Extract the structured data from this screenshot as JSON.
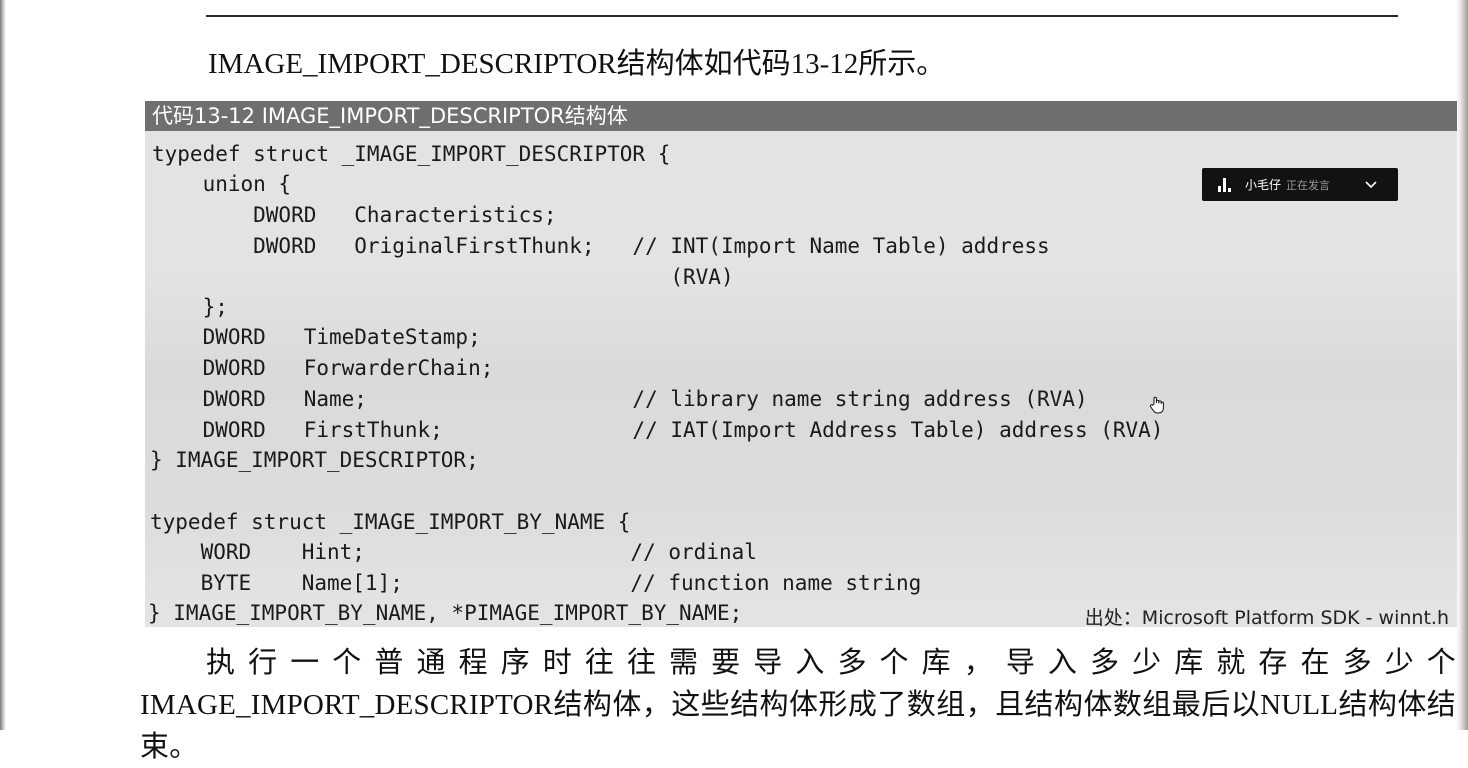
{
  "intro_text": "IMAGE_IMPORT_DESCRIPTOR结构体如代码13-12所示。",
  "code_block": {
    "header": "代码13-12   IMAGE_IMPORT_DESCRIPTOR结构体",
    "lines": [
      "typedef struct _IMAGE_IMPORT_DESCRIPTOR {",
      "    union {",
      "        DWORD   Characteristics;",
      "        DWORD   OriginalFirstThunk;   // INT(Import Name Table) address",
      "                                         (RVA)",
      "    };",
      "    DWORD   TimeDateStamp;",
      "    DWORD   ForwarderChain;",
      "    DWORD   Name;                     // library name string address (RVA)",
      "    DWORD   FirstThunk;               // IAT(Import Address Table) address (RVA)",
      "} IMAGE_IMPORT_DESCRIPTOR;",
      "",
      "typedef struct _IMAGE_IMPORT_BY_NAME {",
      "    WORD    Hint;                     // ordinal",
      "    BYTE    Name[1];                  // function name string",
      "} IMAGE_IMPORT_BY_NAME, *PIMAGE_IMPORT_BY_NAME;"
    ],
    "source_note": "出处：Microsoft Platform SDK - winnt.h"
  },
  "body_paragraph": "执行一个普通程序时往往需要导入多个库，导入多少库就存在多少个IMAGE_IMPORT_DESCRIPTOR结构体，这些结构体形成了数组，且结构体数组最后以NULL结构体结束。",
  "voice_overlay": {
    "speaker": "小毛仔",
    "status": "正在发言"
  },
  "colors": {
    "code_background": "#e3e3e3",
    "code_header_background": "#6f6f6f",
    "overlay_background": "#121212"
  }
}
